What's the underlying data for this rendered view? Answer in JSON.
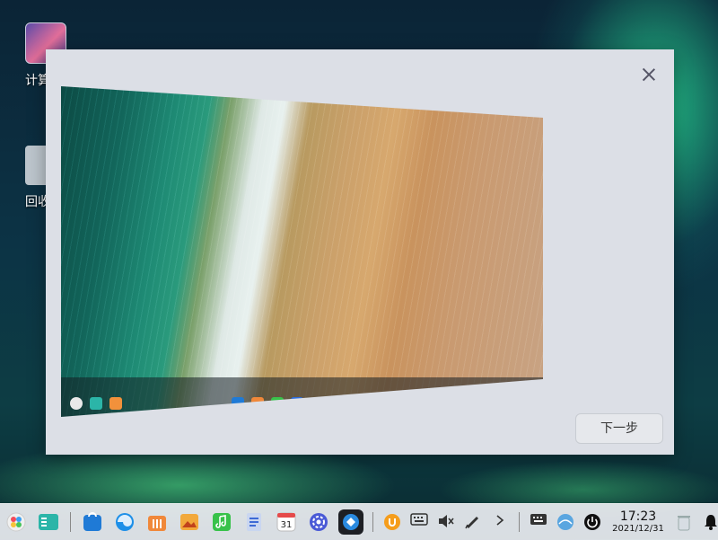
{
  "desktop": {
    "icons": [
      {
        "label": "计算机"
      },
      {
        "label": "回收站"
      }
    ]
  },
  "dialog": {
    "next_label": "下一步"
  },
  "taskbar": {
    "time": "17:23",
    "date": "2021/12/31",
    "calendar_day": "31",
    "colors": {
      "launcher": "#f24b5c",
      "files": "#2bb5a8",
      "store": "#1f7ad6",
      "browser": "#1d8fe8",
      "music": "#38c24a",
      "active_app": "#1d1f24"
    }
  }
}
